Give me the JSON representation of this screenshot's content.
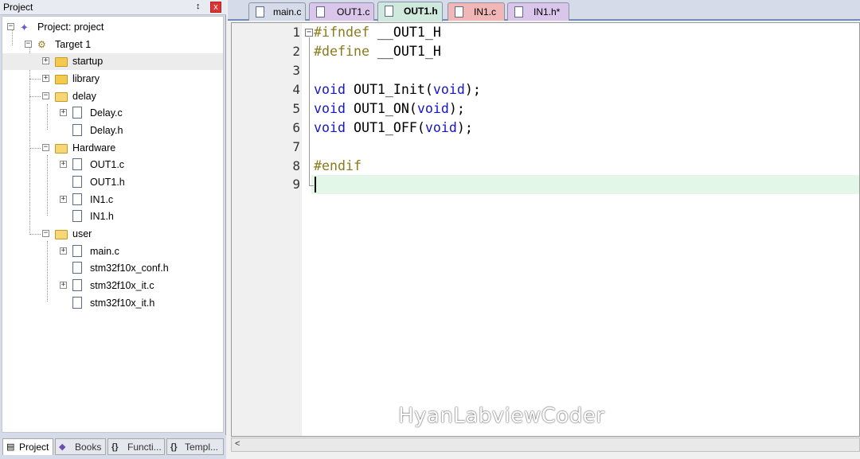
{
  "panel": {
    "title": "Project",
    "pin_glyph": "ᵰ",
    "close_glyph": "x"
  },
  "tree": {
    "project": "Project: project",
    "target": "Target 1",
    "groups": {
      "startup": "startup",
      "library": "library",
      "delay": "delay",
      "hardware": "Hardware",
      "user": "user"
    },
    "files": {
      "delay_c": "Delay.c",
      "delay_h": "Delay.h",
      "out1_c": "OUT1.c",
      "out1_h": "OUT1.h",
      "in1_c": "IN1.c",
      "in1_h": "IN1.h",
      "main_c": "main.c",
      "conf_h": "stm32f10x_conf.h",
      "it_c": "stm32f10x_it.c",
      "it_h": "stm32f10x_it.h"
    }
  },
  "bottom_tabs": [
    {
      "label": "Project",
      "icon": "project-icon"
    },
    {
      "label": "Books",
      "icon": "books-icon"
    },
    {
      "label": "Functi...",
      "icon": "functions-icon"
    },
    {
      "label": "Templ...",
      "icon": "templates-icon"
    }
  ],
  "file_tabs": [
    {
      "label": "main.c",
      "color": "#d6dbe9"
    },
    {
      "label": "OUT1.c",
      "color": "#d9c6ea"
    },
    {
      "label": "OUT1.h",
      "color": "#cfe9dc"
    },
    {
      "label": "IN1.c",
      "color": "#f1b6b6"
    },
    {
      "label": "IN1.h*",
      "color": "#d9c6ea"
    }
  ],
  "editor": {
    "line_numbers": [
      "1",
      "2",
      "3",
      "4",
      "5",
      "6",
      "7",
      "8",
      "9"
    ],
    "code": {
      "l1_pp": "#ifndef",
      "l1_rest": " __OUT1_H",
      "l2_pp": "#define",
      "l2_rest": " __OUT1_H",
      "l4_kw": "void",
      "l4_mid": " OUT1_Init(",
      "l4_arg": "void",
      "l4_end": ");",
      "l5_kw": "void",
      "l5_mid": " OUT1_ON(",
      "l5_arg": "void",
      "l5_end": ");",
      "l6_kw": "void",
      "l6_mid": " OUT1_OFF(",
      "l6_arg": "void",
      "l6_end": ");",
      "l8_pp": "#endif"
    },
    "current_line_color": "#e3f7e9",
    "scroll_arrow": "<"
  },
  "watermark": "HyanLabviewCoder"
}
